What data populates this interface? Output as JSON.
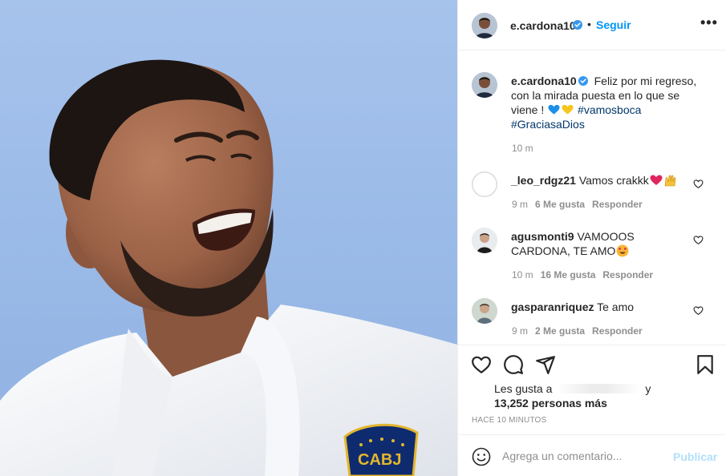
{
  "post": {
    "author": "e.cardona10",
    "follow_label": "Seguir",
    "separator": "•",
    "more_label": "•••",
    "colors": {
      "accent": "#0095f6",
      "hashtag": "#00376b",
      "muted": "#8e8e8e",
      "publish_disabled": "#b2dffc"
    }
  },
  "caption": {
    "author": "e.cardona10",
    "text": "Feliz por mi regreso, con la mirada puesta en lo que se viene !",
    "emojis": [
      "blue-heart",
      "yellow-heart"
    ],
    "hashtag_1": "#vamosboca",
    "hashtag_2": "#GraciasaDios",
    "time": "10 m"
  },
  "comments": [
    {
      "user": "_leo_rdgz21",
      "text": "Vamos crakkk",
      "emojis": [
        "red-heart",
        "raising-hands"
      ],
      "time": "9 m",
      "likes": "6 Me gusta",
      "reply": "Responder"
    },
    {
      "user": "agusmonti9",
      "text": "VAMOOOS CARDONA, TE AMO",
      "emojis": [
        "heart-eyes-face"
      ],
      "time": "10 m",
      "likes": "16 Me gusta",
      "reply": "Responder"
    },
    {
      "user": "gasparanriquez",
      "text": "Te amo",
      "emojis": [],
      "time": "9 m",
      "likes": "2 Me gusta",
      "reply": "Responder"
    }
  ],
  "actions": {
    "icons": [
      "heart-icon",
      "comment-icon",
      "share-icon",
      "bookmark-icon"
    ],
    "likes_prefix": "Les gusta a",
    "likes_conjunction": "y",
    "likes_count": "13,252 personas más",
    "posted_ago": "HACE 10 MINUTOS"
  },
  "add_comment": {
    "placeholder": "Agrega un comentario...",
    "publish_label": "Publicar"
  },
  "photo": {
    "badge_text": "CABJ"
  }
}
